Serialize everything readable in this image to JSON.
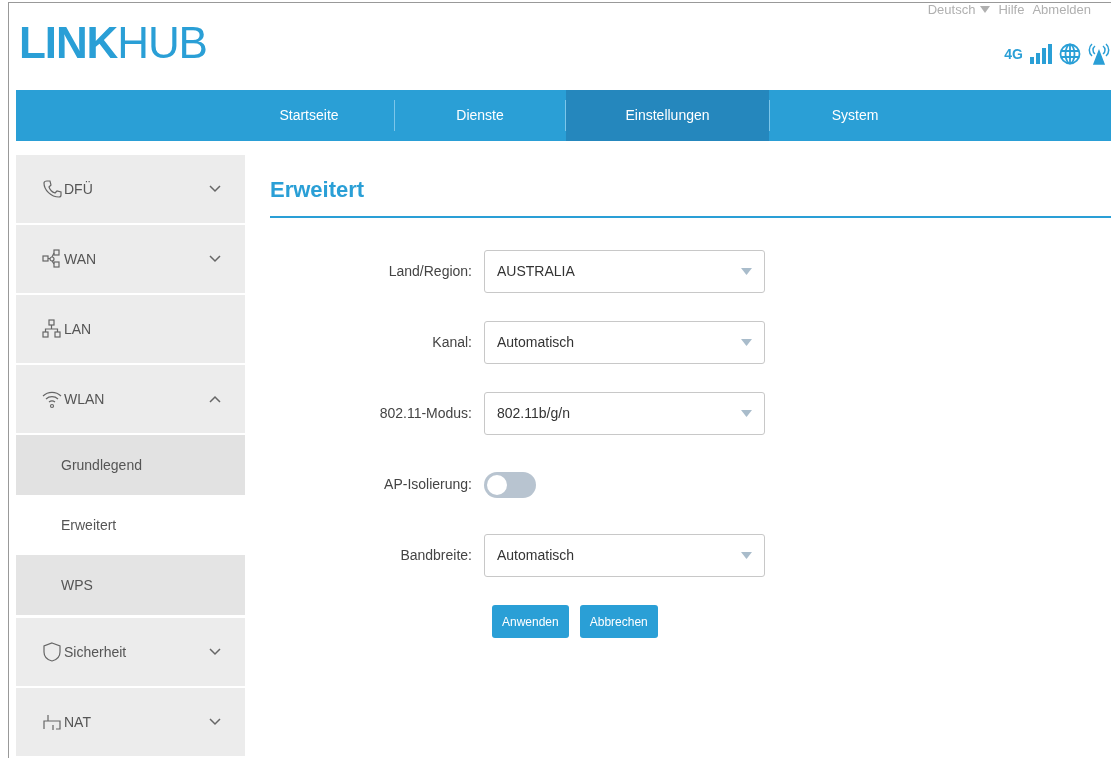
{
  "header": {
    "logo_bold": "LINK",
    "logo_light": "HUB",
    "top_links": [
      {
        "label": "Deutsch",
        "kind": "dropdown"
      },
      {
        "label": "Hilfe",
        "kind": "link"
      },
      {
        "label": "Abmelden",
        "kind": "link"
      }
    ],
    "network_type": "4G"
  },
  "nav": [
    {
      "label": "Startseite",
      "selected": false
    },
    {
      "label": "Dienste",
      "selected": false
    },
    {
      "label": "Einstellungen",
      "selected": true
    },
    {
      "label": "System",
      "selected": false
    }
  ],
  "sidebar": [
    {
      "label": "DFÜ",
      "kind": "phone",
      "expanded": false
    },
    {
      "label": "WAN",
      "kind": "nodes",
      "expanded": false
    },
    {
      "label": "LAN",
      "kind": "lan"
    },
    {
      "label": "WLAN",
      "kind": "wifi",
      "expanded": true,
      "children": [
        {
          "label": "Grundlegend",
          "selected": false
        },
        {
          "label": "Erweitert",
          "selected": true
        },
        {
          "label": "WPS",
          "selected": false
        }
      ]
    },
    {
      "label": "Sicherheit",
      "kind": "shield",
      "expanded": false
    },
    {
      "label": "NAT",
      "kind": "nat",
      "expanded": false
    }
  ],
  "page_title": "Erweitert",
  "form": [
    {
      "kind": "select",
      "label": "Land/Region:",
      "value": "AUSTRALIA"
    },
    {
      "kind": "select",
      "label": "Kanal:",
      "value": "Automatisch"
    },
    {
      "kind": "select",
      "label": "802.11-Modus:",
      "value": "802.11b/g/n"
    },
    {
      "kind": "toggle",
      "label": "AP-Isolierung:",
      "on": false
    },
    {
      "kind": "select",
      "label": "Bandbreite:",
      "value": "Automatisch"
    }
  ],
  "buttons": [
    "Anwenden",
    "Abbrechen"
  ]
}
